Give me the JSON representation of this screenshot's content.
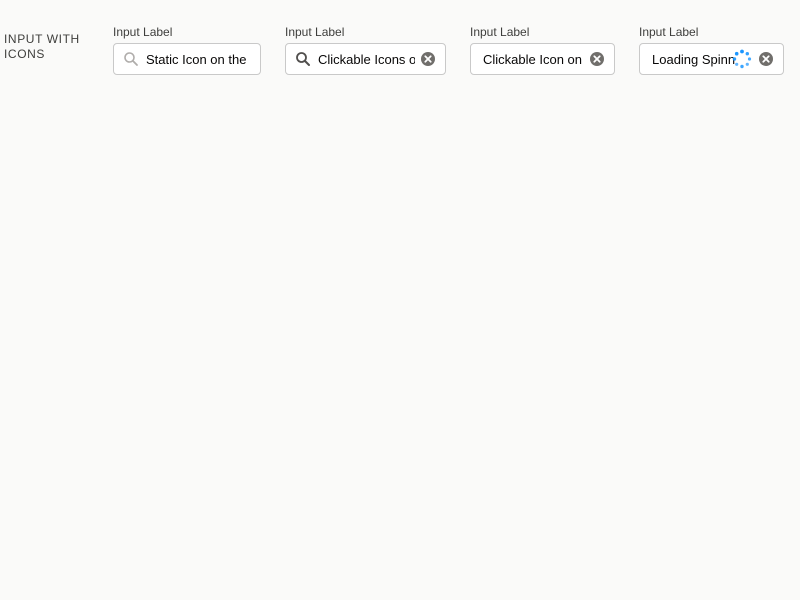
{
  "section": {
    "title": "Input with Icons"
  },
  "fields": [
    {
      "label": "Input Label",
      "value": "Static Icon on the Left",
      "icons": [
        "search-icon"
      ]
    },
    {
      "label": "Input Label",
      "value": "Clickable Icons on Left and Right",
      "icons": [
        "search-icon",
        "clear-icon"
      ]
    },
    {
      "label": "Input Label",
      "value": "Clickable Icon on the Right",
      "icons": [
        "clear-icon"
      ]
    },
    {
      "label": "Input Label",
      "value": "Loading Spinner",
      "icons": [
        "spinner-icon",
        "clear-icon"
      ]
    }
  ],
  "colors": {
    "background": "#fafaf9",
    "border": "#c9c9c9",
    "icon_gray": "#706e6b",
    "clear_icon": "#706e6b",
    "spinner_blue": "#1b96ff"
  }
}
